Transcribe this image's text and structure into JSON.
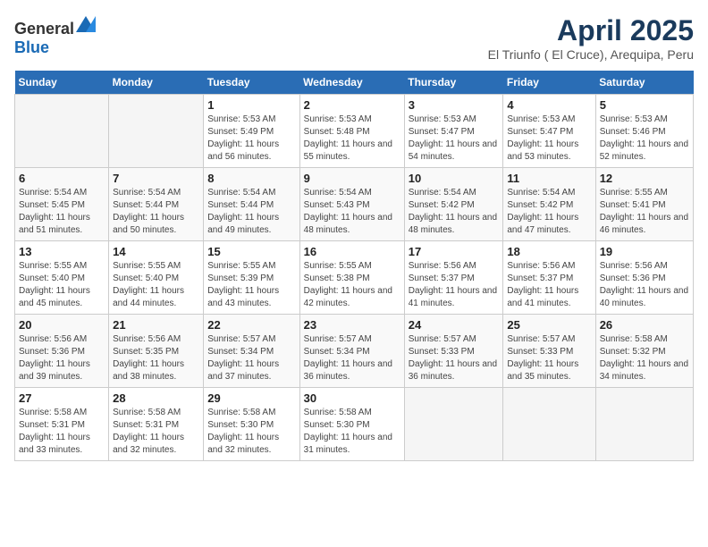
{
  "header": {
    "logo_general": "General",
    "logo_blue": "Blue",
    "title": "April 2025",
    "subtitle": "El Triunfo ( El Cruce), Arequipa, Peru"
  },
  "calendar": {
    "days_of_week": [
      "Sunday",
      "Monday",
      "Tuesday",
      "Wednesday",
      "Thursday",
      "Friday",
      "Saturday"
    ],
    "weeks": [
      [
        {
          "day": "",
          "sunrise": "",
          "sunset": "",
          "daylight": "",
          "empty": true
        },
        {
          "day": "",
          "sunrise": "",
          "sunset": "",
          "daylight": "",
          "empty": true
        },
        {
          "day": "1",
          "sunrise": "Sunrise: 5:53 AM",
          "sunset": "Sunset: 5:49 PM",
          "daylight": "Daylight: 11 hours and 56 minutes.",
          "empty": false
        },
        {
          "day": "2",
          "sunrise": "Sunrise: 5:53 AM",
          "sunset": "Sunset: 5:48 PM",
          "daylight": "Daylight: 11 hours and 55 minutes.",
          "empty": false
        },
        {
          "day": "3",
          "sunrise": "Sunrise: 5:53 AM",
          "sunset": "Sunset: 5:47 PM",
          "daylight": "Daylight: 11 hours and 54 minutes.",
          "empty": false
        },
        {
          "day": "4",
          "sunrise": "Sunrise: 5:53 AM",
          "sunset": "Sunset: 5:47 PM",
          "daylight": "Daylight: 11 hours and 53 minutes.",
          "empty": false
        },
        {
          "day": "5",
          "sunrise": "Sunrise: 5:53 AM",
          "sunset": "Sunset: 5:46 PM",
          "daylight": "Daylight: 11 hours and 52 minutes.",
          "empty": false
        }
      ],
      [
        {
          "day": "6",
          "sunrise": "Sunrise: 5:54 AM",
          "sunset": "Sunset: 5:45 PM",
          "daylight": "Daylight: 11 hours and 51 minutes.",
          "empty": false
        },
        {
          "day": "7",
          "sunrise": "Sunrise: 5:54 AM",
          "sunset": "Sunset: 5:44 PM",
          "daylight": "Daylight: 11 hours and 50 minutes.",
          "empty": false
        },
        {
          "day": "8",
          "sunrise": "Sunrise: 5:54 AM",
          "sunset": "Sunset: 5:44 PM",
          "daylight": "Daylight: 11 hours and 49 minutes.",
          "empty": false
        },
        {
          "day": "9",
          "sunrise": "Sunrise: 5:54 AM",
          "sunset": "Sunset: 5:43 PM",
          "daylight": "Daylight: 11 hours and 48 minutes.",
          "empty": false
        },
        {
          "day": "10",
          "sunrise": "Sunrise: 5:54 AM",
          "sunset": "Sunset: 5:42 PM",
          "daylight": "Daylight: 11 hours and 48 minutes.",
          "empty": false
        },
        {
          "day": "11",
          "sunrise": "Sunrise: 5:54 AM",
          "sunset": "Sunset: 5:42 PM",
          "daylight": "Daylight: 11 hours and 47 minutes.",
          "empty": false
        },
        {
          "day": "12",
          "sunrise": "Sunrise: 5:55 AM",
          "sunset": "Sunset: 5:41 PM",
          "daylight": "Daylight: 11 hours and 46 minutes.",
          "empty": false
        }
      ],
      [
        {
          "day": "13",
          "sunrise": "Sunrise: 5:55 AM",
          "sunset": "Sunset: 5:40 PM",
          "daylight": "Daylight: 11 hours and 45 minutes.",
          "empty": false
        },
        {
          "day": "14",
          "sunrise": "Sunrise: 5:55 AM",
          "sunset": "Sunset: 5:40 PM",
          "daylight": "Daylight: 11 hours and 44 minutes.",
          "empty": false
        },
        {
          "day": "15",
          "sunrise": "Sunrise: 5:55 AM",
          "sunset": "Sunset: 5:39 PM",
          "daylight": "Daylight: 11 hours and 43 minutes.",
          "empty": false
        },
        {
          "day": "16",
          "sunrise": "Sunrise: 5:55 AM",
          "sunset": "Sunset: 5:38 PM",
          "daylight": "Daylight: 11 hours and 42 minutes.",
          "empty": false
        },
        {
          "day": "17",
          "sunrise": "Sunrise: 5:56 AM",
          "sunset": "Sunset: 5:37 PM",
          "daylight": "Daylight: 11 hours and 41 minutes.",
          "empty": false
        },
        {
          "day": "18",
          "sunrise": "Sunrise: 5:56 AM",
          "sunset": "Sunset: 5:37 PM",
          "daylight": "Daylight: 11 hours and 41 minutes.",
          "empty": false
        },
        {
          "day": "19",
          "sunrise": "Sunrise: 5:56 AM",
          "sunset": "Sunset: 5:36 PM",
          "daylight": "Daylight: 11 hours and 40 minutes.",
          "empty": false
        }
      ],
      [
        {
          "day": "20",
          "sunrise": "Sunrise: 5:56 AM",
          "sunset": "Sunset: 5:36 PM",
          "daylight": "Daylight: 11 hours and 39 minutes.",
          "empty": false
        },
        {
          "day": "21",
          "sunrise": "Sunrise: 5:56 AM",
          "sunset": "Sunset: 5:35 PM",
          "daylight": "Daylight: 11 hours and 38 minutes.",
          "empty": false
        },
        {
          "day": "22",
          "sunrise": "Sunrise: 5:57 AM",
          "sunset": "Sunset: 5:34 PM",
          "daylight": "Daylight: 11 hours and 37 minutes.",
          "empty": false
        },
        {
          "day": "23",
          "sunrise": "Sunrise: 5:57 AM",
          "sunset": "Sunset: 5:34 PM",
          "daylight": "Daylight: 11 hours and 36 minutes.",
          "empty": false
        },
        {
          "day": "24",
          "sunrise": "Sunrise: 5:57 AM",
          "sunset": "Sunset: 5:33 PM",
          "daylight": "Daylight: 11 hours and 36 minutes.",
          "empty": false
        },
        {
          "day": "25",
          "sunrise": "Sunrise: 5:57 AM",
          "sunset": "Sunset: 5:33 PM",
          "daylight": "Daylight: 11 hours and 35 minutes.",
          "empty": false
        },
        {
          "day": "26",
          "sunrise": "Sunrise: 5:58 AM",
          "sunset": "Sunset: 5:32 PM",
          "daylight": "Daylight: 11 hours and 34 minutes.",
          "empty": false
        }
      ],
      [
        {
          "day": "27",
          "sunrise": "Sunrise: 5:58 AM",
          "sunset": "Sunset: 5:31 PM",
          "daylight": "Daylight: 11 hours and 33 minutes.",
          "empty": false
        },
        {
          "day": "28",
          "sunrise": "Sunrise: 5:58 AM",
          "sunset": "Sunset: 5:31 PM",
          "daylight": "Daylight: 11 hours and 32 minutes.",
          "empty": false
        },
        {
          "day": "29",
          "sunrise": "Sunrise: 5:58 AM",
          "sunset": "Sunset: 5:30 PM",
          "daylight": "Daylight: 11 hours and 32 minutes.",
          "empty": false
        },
        {
          "day": "30",
          "sunrise": "Sunrise: 5:58 AM",
          "sunset": "Sunset: 5:30 PM",
          "daylight": "Daylight: 11 hours and 31 minutes.",
          "empty": false
        },
        {
          "day": "",
          "sunrise": "",
          "sunset": "",
          "daylight": "",
          "empty": true
        },
        {
          "day": "",
          "sunrise": "",
          "sunset": "",
          "daylight": "",
          "empty": true
        },
        {
          "day": "",
          "sunrise": "",
          "sunset": "",
          "daylight": "",
          "empty": true
        }
      ]
    ]
  }
}
